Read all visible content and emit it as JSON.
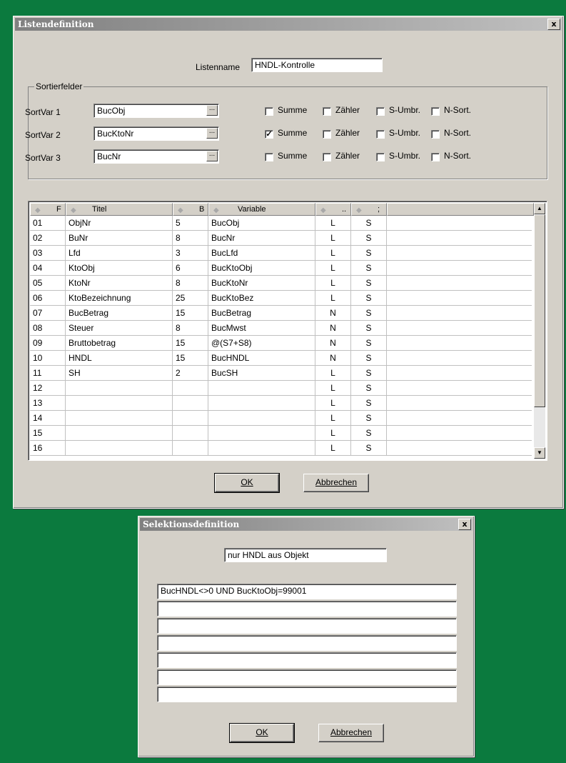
{
  "listdef": {
    "title": "Listendefinition",
    "close": "x",
    "listenname_label": "Listenname",
    "listenname_value": "HNDL-Kontrolle",
    "sort_group_label": "Sortierfelder",
    "sort_rows": [
      {
        "label": "SortVar 1",
        "value": "BucObj",
        "summe": false
      },
      {
        "label": "SortVar 2",
        "value": "BucKtoNr",
        "summe": true
      },
      {
        "label": "SortVar 3",
        "value": "BucNr",
        "summe": false
      }
    ],
    "dots": "...",
    "cb_summe": "Summe",
    "cb_zaehler": "Zähler",
    "cb_sumbr": "S-Umbr.",
    "cb_nsort": "N-Sort.",
    "headers": {
      "f": "F",
      "titel": "Titel",
      "b": "B",
      "variable": "Variable",
      "c5": "..",
      "c6": ";"
    },
    "rows": [
      [
        "01",
        "ObjNr",
        "5",
        "BucObj",
        "L",
        "S"
      ],
      [
        "02",
        "BuNr",
        "8",
        "BucNr",
        "L",
        "S"
      ],
      [
        "03",
        "Lfd",
        "3",
        "BucLfd",
        "L",
        "S"
      ],
      [
        "04",
        "KtoObj",
        "6",
        "BucKtoObj",
        "L",
        "S"
      ],
      [
        "05",
        "KtoNr",
        "8",
        "BucKtoNr",
        "L",
        "S"
      ],
      [
        "06",
        "KtoBezeichnung",
        "25",
        "BucKtoBez",
        "L",
        "S"
      ],
      [
        "07",
        "BucBetrag",
        "15",
        "BucBetrag",
        "N",
        "S"
      ],
      [
        "08",
        "Steuer",
        "8",
        "BucMwst",
        "N",
        "S"
      ],
      [
        "09",
        "Bruttobetrag",
        "15",
        "@(S7+S8)",
        "N",
        "S"
      ],
      [
        "10",
        "HNDL",
        "15",
        "BucHNDL",
        "N",
        "S"
      ],
      [
        "11",
        "SH",
        "2",
        "BucSH",
        "L",
        "S"
      ],
      [
        "12",
        "",
        "",
        "",
        "L",
        "S"
      ],
      [
        "13",
        "",
        "",
        "",
        "L",
        "S"
      ],
      [
        "14",
        "",
        "",
        "",
        "L",
        "S"
      ],
      [
        "15",
        "",
        "",
        "",
        "L",
        "S"
      ],
      [
        "16",
        "",
        "",
        "",
        "L",
        "S"
      ]
    ],
    "ok": "OK",
    "cancel": "Abbrechen"
  },
  "seldef": {
    "title": "Selektionsdefinition",
    "close": "x",
    "name_value": "nur HNDL aus Objekt",
    "conditions": [
      "BucHNDL<>0 UND BucKtoObj=99001",
      "",
      "",
      "",
      "",
      "",
      ""
    ],
    "ok": "OK",
    "cancel": "Abbrechen"
  }
}
